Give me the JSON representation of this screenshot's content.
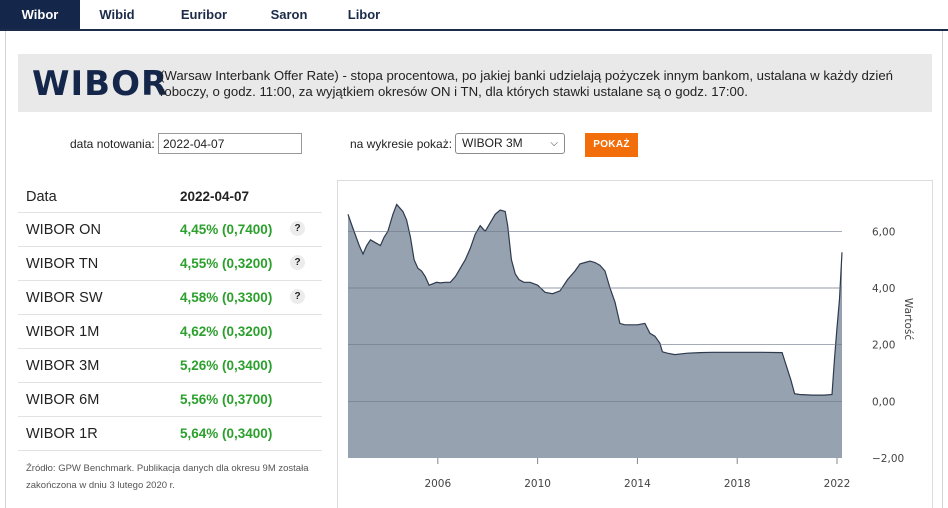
{
  "tabs": [
    {
      "label": "Wibor",
      "active": true
    },
    {
      "label": "Wibid",
      "active": false
    },
    {
      "label": "Euribor",
      "active": false
    },
    {
      "label": "Saron",
      "active": false
    },
    {
      "label": "Libor",
      "active": false
    }
  ],
  "banner": {
    "title": "WIBOR",
    "description": "(Warsaw Interbank Offer Rate) - stopa procentowa, po jakiej banki udzielają pożyczek innym bankom, ustalana w każdy dzień roboczy, o godz. 11:00, za wyjątkiem okresów ON i TN, dla których stawki ustalane są o godz. 17:00."
  },
  "form": {
    "date_label": "data notowania:",
    "date_value": "2022-04-07",
    "chart_label": "na wykresie pokaż:",
    "selected_series": "WIBOR 3M",
    "show_button": "POKAŻ"
  },
  "rates_table": {
    "header": {
      "name": "Data",
      "value": "2022-04-07"
    },
    "rows": [
      {
        "name": "WIBOR ON",
        "value": "4,45% (0,7400)",
        "help": "?"
      },
      {
        "name": "WIBOR TN",
        "value": "4,55% (0,3200)",
        "help": "?"
      },
      {
        "name": "WIBOR SW",
        "value": "4,58% (0,3300)",
        "help": "?"
      },
      {
        "name": "WIBOR 1M",
        "value": "4,62% (0,3200)"
      },
      {
        "name": "WIBOR 3M",
        "value": "5,26% (0,3400)"
      },
      {
        "name": "WIBOR 6M",
        "value": "5,56% (0,3700)"
      },
      {
        "name": "WIBOR 1R",
        "value": "5,64% (0,3400)"
      }
    ],
    "source": "Źródło: GPW Benchmark. Publikacja danych dla okresu 9M została zakończona w dniu 3 lutego 2020 r."
  },
  "chart_data": {
    "type": "area",
    "ylabel": "Wartość",
    "xlim": [
      2002.4,
      2022.2
    ],
    "ylim": [
      -2,
      7
    ],
    "xticks": [
      2006,
      2010,
      2014,
      2018,
      2022
    ],
    "xtick_labels": [
      "2006",
      "2010",
      "2014",
      "2018",
      "2022"
    ],
    "yticks": [
      -2,
      0,
      2,
      4,
      6
    ],
    "ytick_labels": [
      "−2,00",
      "0,00",
      "2,00",
      "4,00",
      "6,00"
    ],
    "grid": true,
    "fill_color": "#97a2b0",
    "line_color": "#2e3a4e",
    "series": [
      {
        "x": [
          2002.4,
          2002.6,
          2002.85,
          2003.0,
          2003.15,
          2003.3,
          2003.5,
          2003.7,
          2003.85,
          2004.0,
          2004.2,
          2004.35,
          2004.5,
          2004.6,
          2004.75,
          2004.9,
          2005.05,
          2005.2,
          2005.35,
          2005.5,
          2005.65,
          2005.8,
          2005.95,
          2006.1,
          2006.3,
          2006.5,
          2006.7,
          2006.9,
          2007.1,
          2007.3,
          2007.5,
          2007.7,
          2007.9,
          2008.1,
          2008.3,
          2008.5,
          2008.7,
          2008.8,
          2008.95,
          2009.1,
          2009.25,
          2009.45,
          2009.7,
          2010.0,
          2010.3,
          2010.6,
          2010.9,
          2011.2,
          2011.5,
          2011.7,
          2011.9,
          2012.1,
          2012.3,
          2012.5,
          2012.7,
          2012.9,
          2013.1,
          2013.3,
          2013.5,
          2013.7,
          2014.0,
          2014.3,
          2014.5,
          2014.7,
          2014.9,
          2015.0,
          2015.2,
          2015.5,
          2016.0,
          2016.5,
          2017.0,
          2018.0,
          2019.0,
          2019.8,
          2020.15,
          2020.3,
          2020.5,
          2021.0,
          2021.5,
          2021.8,
          2021.9,
          2022.0,
          2022.1,
          2022.2
        ],
        "y": [
          6.6,
          6.1,
          5.5,
          5.2,
          5.5,
          5.7,
          5.6,
          5.5,
          5.8,
          6.0,
          6.6,
          6.95,
          6.8,
          6.7,
          6.4,
          5.8,
          5.0,
          4.7,
          4.6,
          4.4,
          4.1,
          4.15,
          4.2,
          4.18,
          4.2,
          4.2,
          4.4,
          4.7,
          5.0,
          5.4,
          5.9,
          6.2,
          6.0,
          6.3,
          6.6,
          6.75,
          6.7,
          6.2,
          5.0,
          4.5,
          4.3,
          4.2,
          4.2,
          4.1,
          3.85,
          3.8,
          3.9,
          4.3,
          4.6,
          4.85,
          4.9,
          4.95,
          4.9,
          4.8,
          4.6,
          4.0,
          3.5,
          2.75,
          2.7,
          2.7,
          2.7,
          2.75,
          2.4,
          2.3,
          2.05,
          1.75,
          1.7,
          1.65,
          1.7,
          1.72,
          1.73,
          1.73,
          1.73,
          1.72,
          0.75,
          0.27,
          0.24,
          0.22,
          0.22,
          0.24,
          1.5,
          2.6,
          3.6,
          5.26
        ]
      }
    ]
  }
}
